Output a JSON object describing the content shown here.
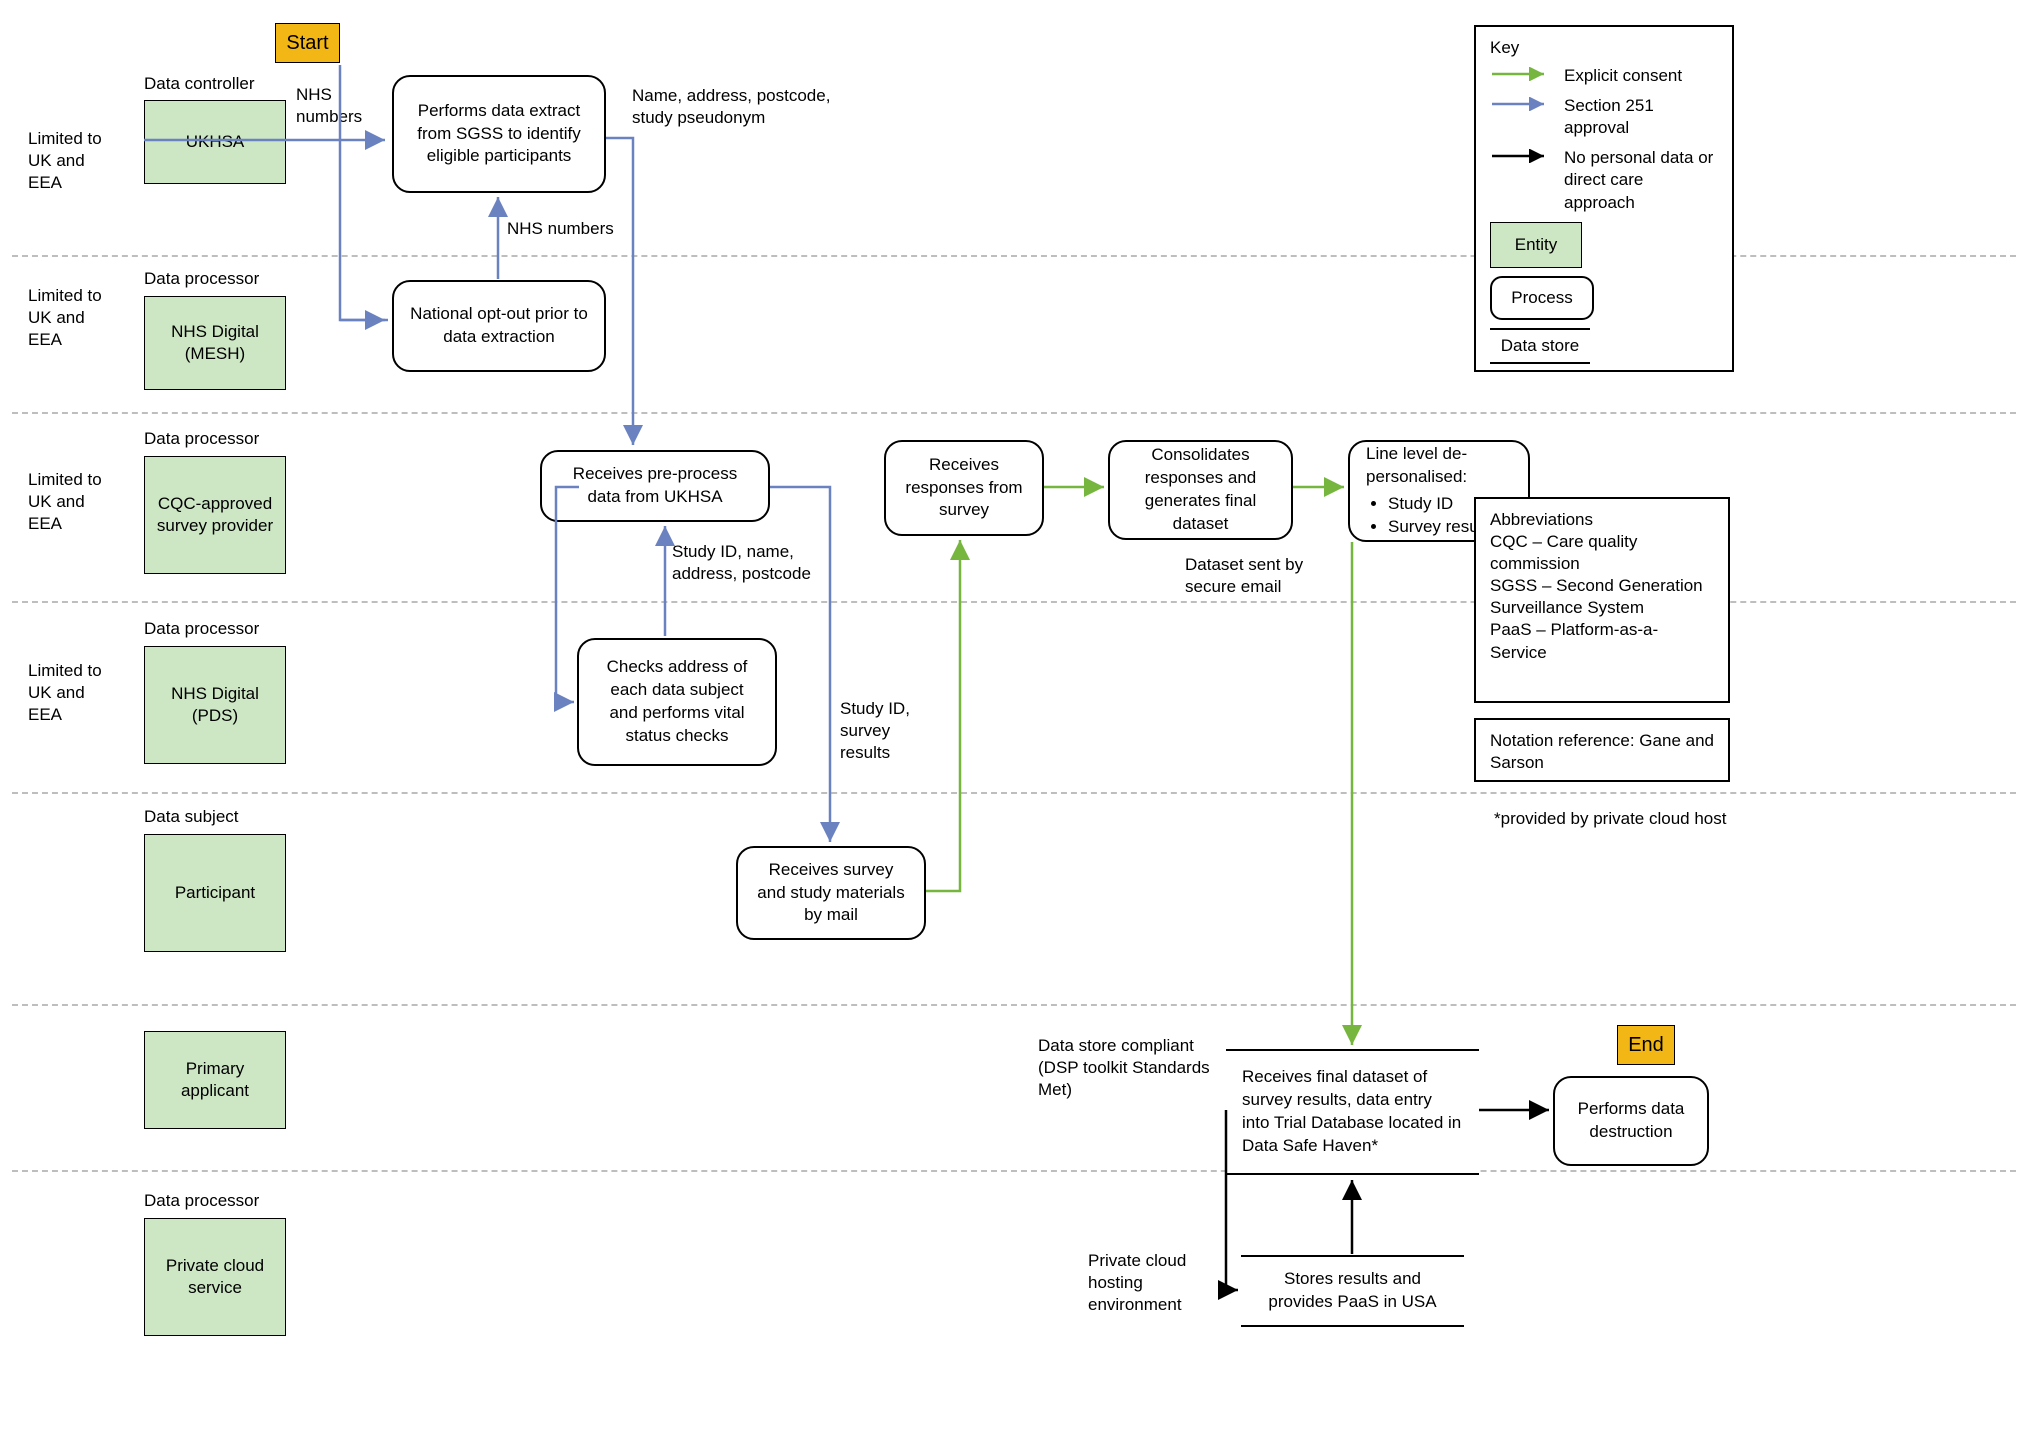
{
  "tags": {
    "start": "Start",
    "end": "End"
  },
  "lanes": {
    "l1": {
      "constraint": "Limited to UK and EEA",
      "role": "Data controller",
      "entity": "UKHSA"
    },
    "l2": {
      "constraint": "Limited to UK and EEA",
      "role": "Data processor",
      "entity": "NHS Digital (MESH)"
    },
    "l3": {
      "constraint": "Limited to UK and EEA",
      "role": "Data processor",
      "entity": "CQC-approved survey provider"
    },
    "l4": {
      "constraint": "Limited to UK and EEA",
      "role": "Data processor",
      "entity": "NHS Digital (PDS)"
    },
    "l5": {
      "constraint": "",
      "role": "Data subject",
      "entity": "Participant"
    },
    "l6": {
      "constraint": "",
      "role": "",
      "entity": "Primary applicant"
    },
    "l7": {
      "constraint": "",
      "role": "Data processor",
      "entity": "Private cloud service"
    }
  },
  "processes": {
    "p1": "Performs data extract from SGSS to identify eligible participants",
    "p2": "National opt-out prior to data extraction",
    "p3": "Receives pre-process data from UKHSA",
    "p4": "Checks address of each data subject and performs vital status checks",
    "p5": "Receives survey and study materials by mail",
    "p6": "Receives responses from survey",
    "p7": "Consolidates responses and generates final dataset",
    "p8_head": "Line level de-personalised:",
    "p8_b1": "Study ID",
    "p8_b2": "Survey results",
    "p10": "Performs data destruction"
  },
  "datastores": {
    "d1": "Receives final dataset of survey results, data entry into Trial Database located in Data Safe Haven*",
    "d2": "Stores results and provides PaaS in USA"
  },
  "labels": {
    "nhs_numbers_a": "NHS numbers",
    "nhs_numbers_b": "NHS numbers",
    "name_addr": "Name, address, postcode, study pseudonym",
    "study_id_name": "Study ID, name, address, postcode",
    "study_id_results": "Study ID, survey results",
    "dataset_sent": "Dataset sent by secure email",
    "dsp": "Data store compliant (DSP toolkit Standards Met)",
    "cloud_env": "Private cloud hosting environment",
    "asterisk": "*provided by private cloud host"
  },
  "key": {
    "title": "Key",
    "explicit": "Explicit consent",
    "s251": "Section 251 approval",
    "noData": "No personal data or direct care approach",
    "entity": "Entity",
    "process": "Process",
    "store": "Data store"
  },
  "abbr": "Abbreviations\nCQC – Care quality commission\nSGSS – Second Generation Surveillance System\nPaaS – Platform-as-a-Service",
  "notation": "Notation reference: Gane and Sarson"
}
